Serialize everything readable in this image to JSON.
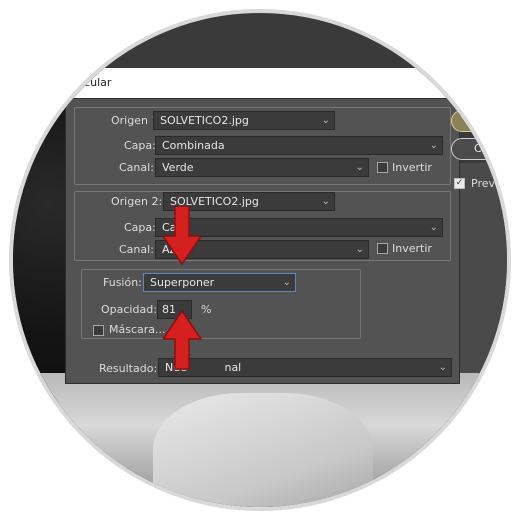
{
  "window": {
    "title_fragment": "lcular"
  },
  "source1": {
    "origin_label": "Origen 1:",
    "origin_value": "SOLVETICO2.jpg",
    "layer_label": "Capa:",
    "layer_value": "Combinada",
    "channel_label": "Canal:",
    "channel_value": "Verde",
    "invert_label": "Invertir",
    "invert_checked": false
  },
  "source2": {
    "origin_label": "Origen 2:",
    "origin_value": "SOLVETICO2.jpg",
    "layer_label": "Capa:",
    "layer_value": "Cap",
    "channel_label": "Canal:",
    "channel_value": "Az",
    "invert_label": "Invertir",
    "invert_checked": false
  },
  "blend": {
    "fusion_label": "Fusión:",
    "fusion_value": "Superponer",
    "opacity_label": "Opacidad:",
    "opacity_value": "81",
    "opacity_unit": "%",
    "mask_label": "Máscara...",
    "mask_checked": false
  },
  "result": {
    "label": "Resultado:",
    "value": "Nue",
    "value_tail": "nal"
  },
  "buttons": {
    "cancel_fragment": "Ca",
    "preview_label": "Previsu",
    "preview_checked": true
  },
  "colors": {
    "dialog_bg": "#535353",
    "field_bg": "#3b3b3b",
    "arrow_red": "#d61f1f",
    "ok_button": "#8b8258"
  },
  "icons": {
    "dropdown": "chevron-down-icon",
    "annotation": "red-arrow-icon"
  }
}
